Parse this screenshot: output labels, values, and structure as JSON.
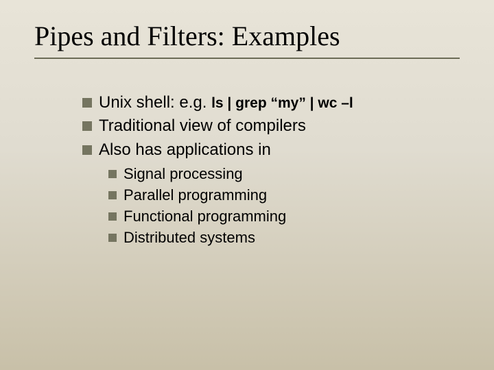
{
  "title": "Pipes and Filters: Examples",
  "bullets": [
    {
      "prefix": "Unix shell: e.g. ",
      "code": "ls | grep “my” | wc –l"
    },
    {
      "text": "Traditional view of compilers"
    },
    {
      "text": "Also has applications in"
    }
  ],
  "sub": [
    "Signal processing",
    "Parallel programming",
    "Functional programming",
    "Distributed systems"
  ]
}
